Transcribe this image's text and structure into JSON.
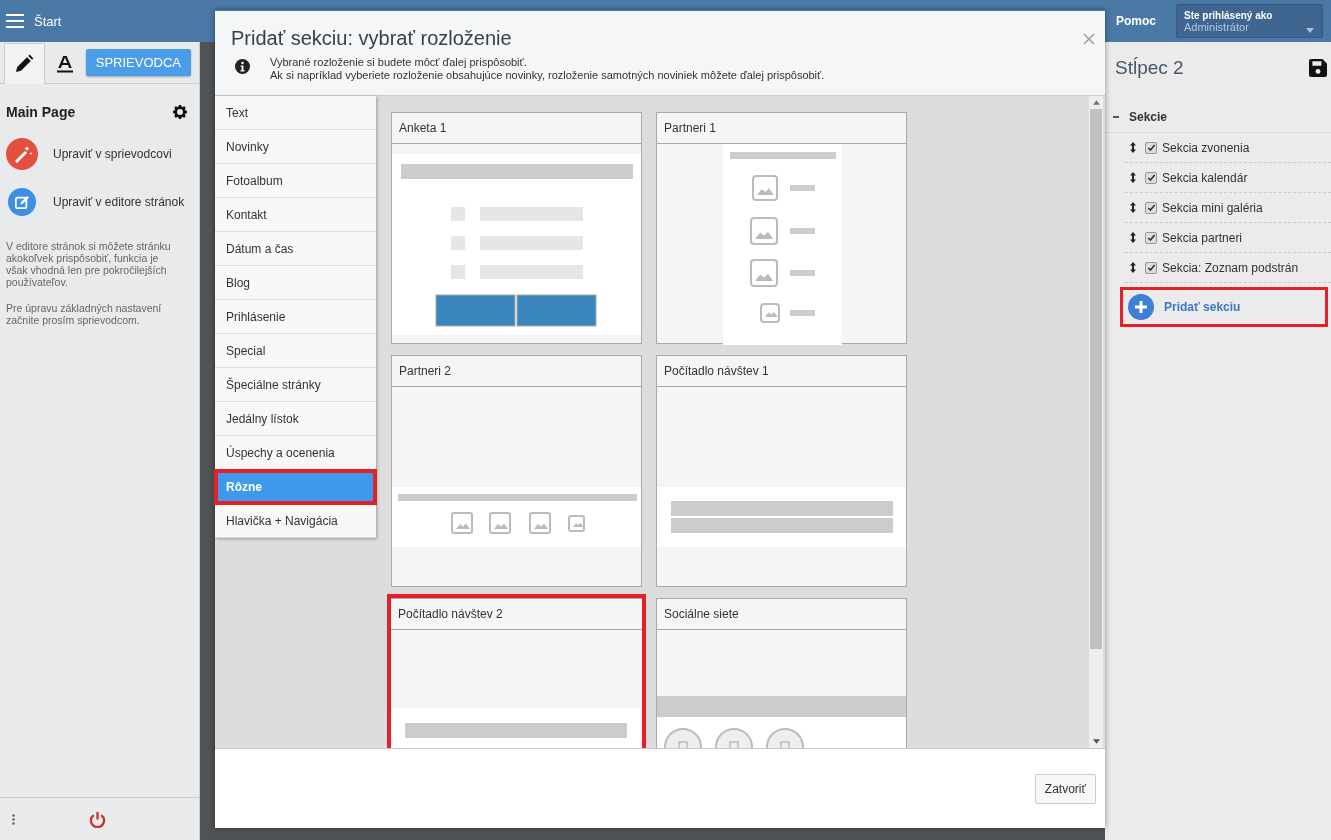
{
  "header": {
    "title": "Štart",
    "help": "Pomoc",
    "user_label": "Ste prihlásený ako",
    "user_name": "Administrátor"
  },
  "sidebar": {
    "tabs": [
      {
        "kind": "pencil",
        "selected": true
      },
      {
        "kind": "text",
        "selected": false
      }
    ],
    "wizard_button": "SPRIEVODCA",
    "page_title": "Main Page",
    "actions": [
      {
        "kind": "wizard",
        "label": "Upraviť v sprievodcovi"
      },
      {
        "kind": "editor",
        "label": "Upraviť v editore stránok"
      }
    ],
    "paragraphs": [
      "V editore stránok si môžete stránku akokoľvek prispôsobiť, funkcia je však vhodná len pre pokročilejších používateľov.",
      "Pre úpravu základných nastavení začnite prosím sprievodcom."
    ]
  },
  "dialog": {
    "title": "Pridať sekciu: vybrať rozloženie",
    "info": [
      "Vybrané rozloženie si budete môcť ďalej prispôsobiť.",
      "Ak si napríklad vyberiete rozloženie obsahujúce novinky, rozloženie samotných noviniek môžete ďalej prispôsobiť."
    ],
    "categories": [
      {
        "label": "Text",
        "selected": false,
        "highlighted": false
      },
      {
        "label": "Novinky",
        "selected": false,
        "highlighted": false
      },
      {
        "label": "Fotoalbum",
        "selected": false,
        "highlighted": false
      },
      {
        "label": "Kontakt",
        "selected": false,
        "highlighted": false
      },
      {
        "label": "Dátum a čas",
        "selected": false,
        "highlighted": false
      },
      {
        "label": "Blog",
        "selected": false,
        "highlighted": false
      },
      {
        "label": "Prihlásenie",
        "selected": false,
        "highlighted": false
      },
      {
        "label": "Special",
        "selected": false,
        "highlighted": false
      },
      {
        "label": "Špeciálne stránky",
        "selected": false,
        "highlighted": false
      },
      {
        "label": "Jedálny lístok",
        "selected": false,
        "highlighted": false
      },
      {
        "label": "Úspechy a ocenenia",
        "selected": false,
        "highlighted": false
      },
      {
        "label": "Rôzne",
        "selected": true,
        "highlighted": true
      },
      {
        "label": "Hlavička + Navigácia",
        "selected": false,
        "highlighted": false
      }
    ],
    "layouts": [
      {
        "title": "Anketa 1",
        "kind": "poll",
        "highlighted": false
      },
      {
        "title": "Partneri 1",
        "kind": "logo-list",
        "highlighted": false
      },
      {
        "title": "Partneri 2",
        "kind": "logo-row",
        "highlighted": false
      },
      {
        "title": "Počítadlo návštev 1",
        "kind": "counter-double",
        "highlighted": false
      },
      {
        "title": "Počítadlo návštev 2",
        "kind": "counter-single",
        "highlighted": true
      },
      {
        "title": "Sociálne siete",
        "kind": "social",
        "highlighted": false
      }
    ],
    "close_button": "Zatvoriť"
  },
  "right_panel": {
    "title": "Stĺpec 2",
    "group": "Sekcie",
    "expanded": true,
    "sections": [
      {
        "label": "Sekcia zvonenia",
        "checked": true
      },
      {
        "label": "Sekcia kalendár",
        "checked": true
      },
      {
        "label": "Sekcia mini galéria",
        "checked": true
      },
      {
        "label": "Sekcia partneri",
        "checked": true
      },
      {
        "label": "Sekcia: Zoznam podstrán",
        "checked": true
      }
    ],
    "add_button": "Pridať sekciu",
    "add_highlighted": true
  }
}
